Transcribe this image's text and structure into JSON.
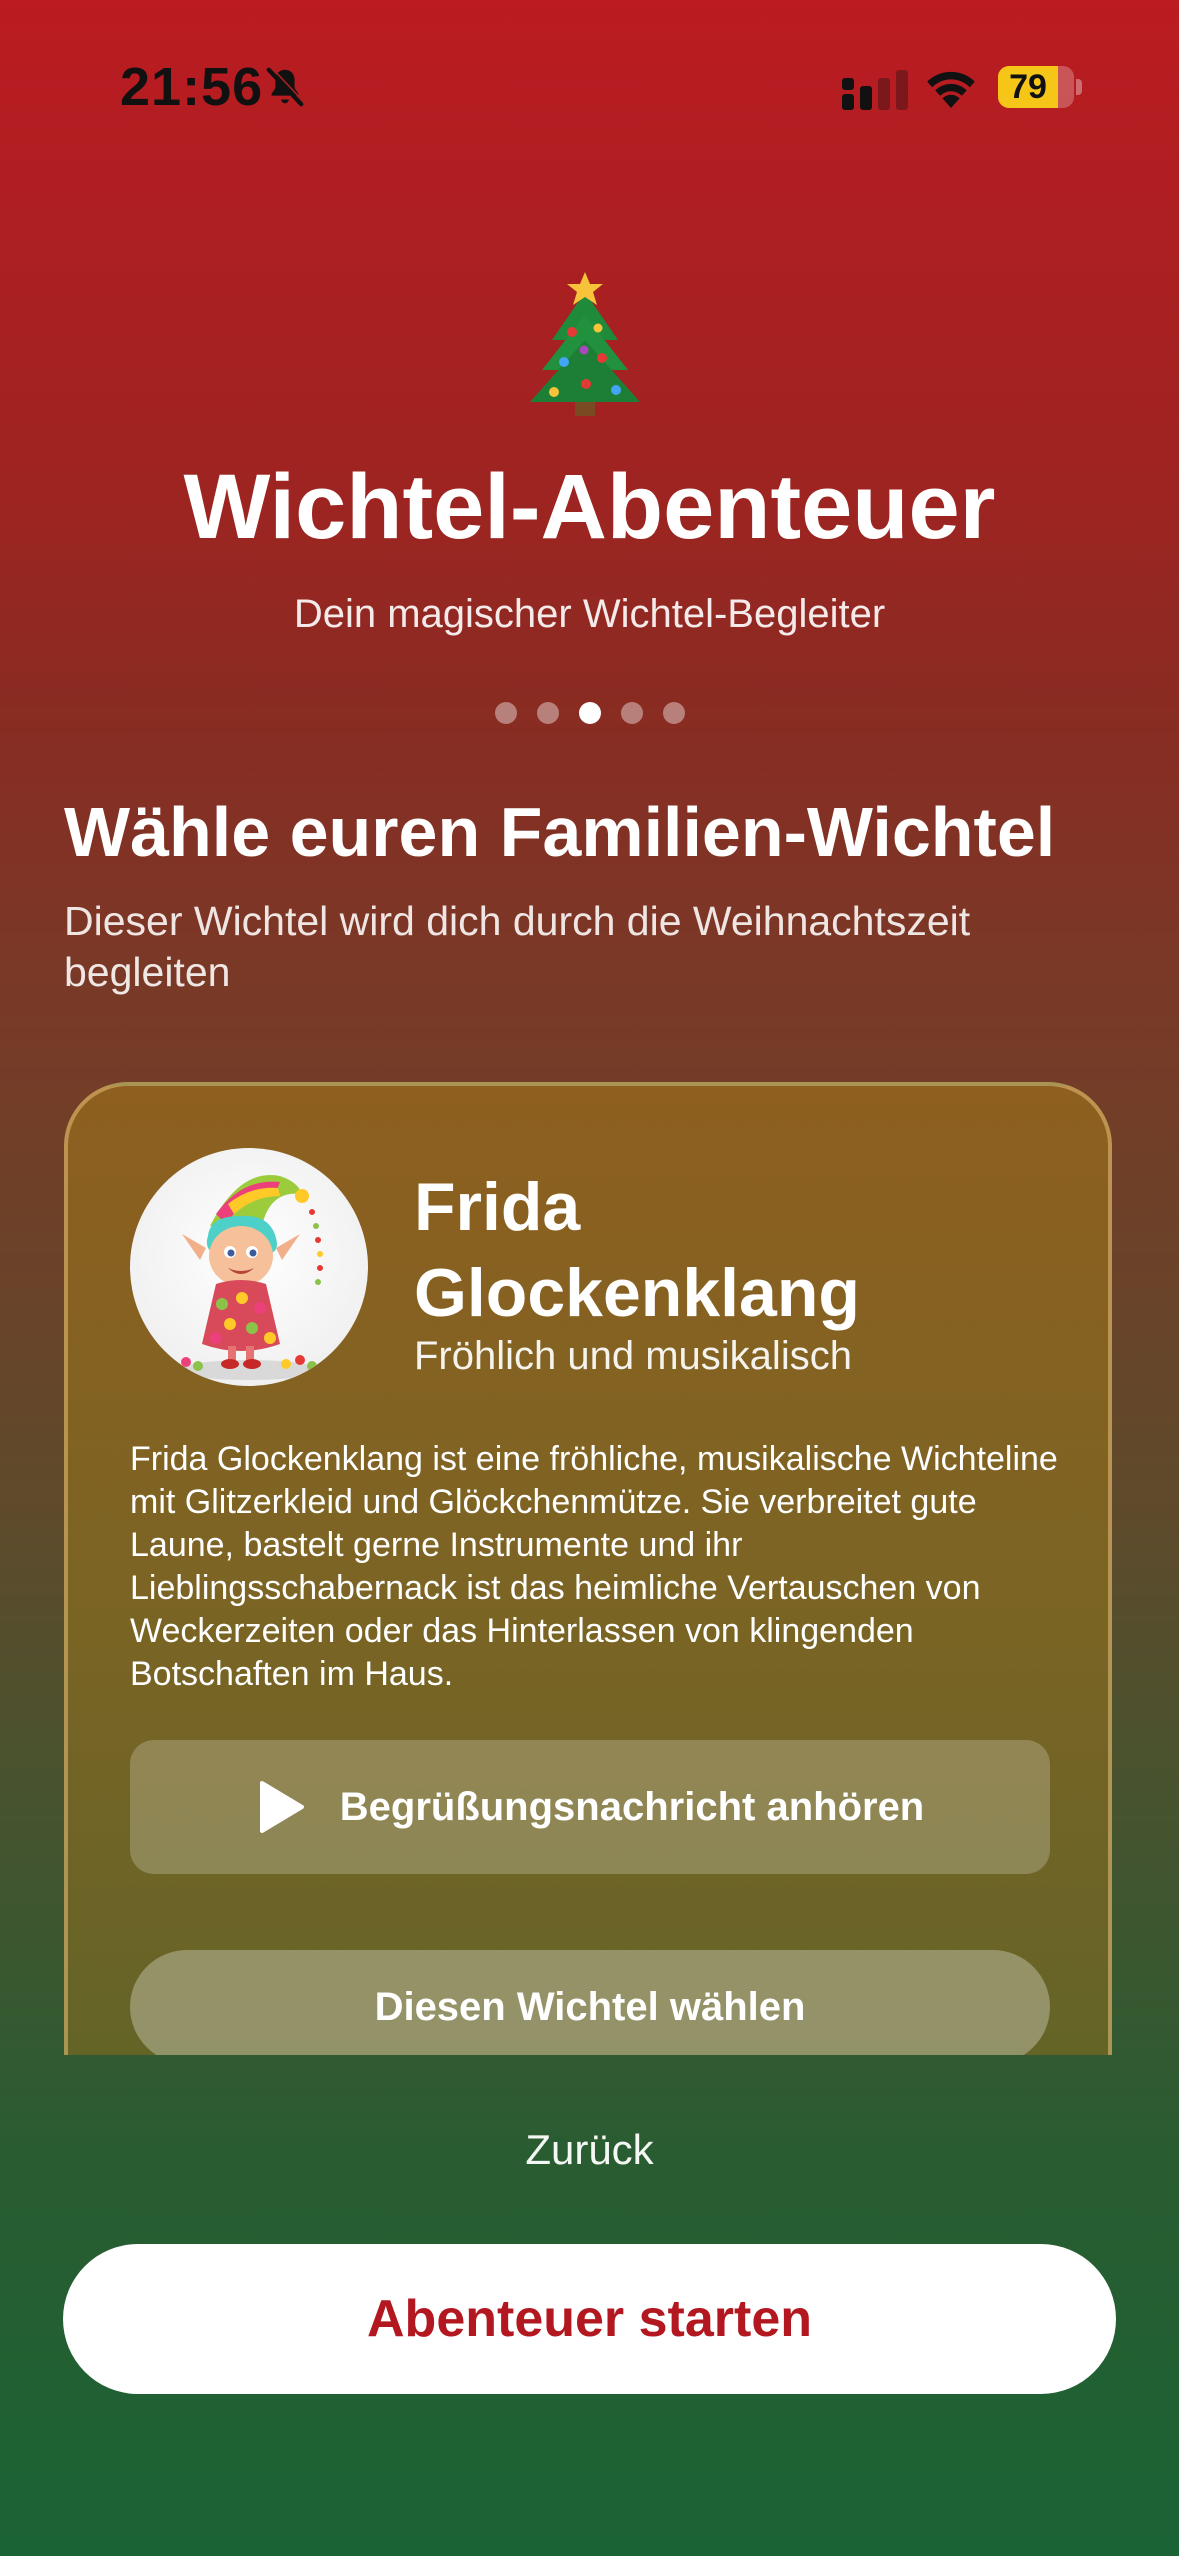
{
  "status_bar": {
    "time": "21:56",
    "battery_percent": "79",
    "battery_level": 0.79,
    "icons": [
      "bell-slash-icon",
      "cellular-signal-icon",
      "wifi-icon",
      "battery-icon"
    ]
  },
  "header": {
    "icon": "christmas-tree-icon",
    "title": "Wichtel-Abenteuer",
    "subtitle": "Dein magischer Wichtel-Begleiter",
    "page_count": 5,
    "current_page": 3
  },
  "section": {
    "title": "Wähle euren Familien-Wichtel",
    "description": "Dieser Wichtel wird dich durch die Weihnachtszeit begleiten"
  },
  "elf_card": {
    "name": "Frida Glockenklang",
    "trait": "Fröhlich und musikalisch",
    "description": "Frida Glockenklang ist eine fröhliche, musikalische Wichteline mit Glitzerkleid und Glöckchenmütze. Sie verbreitet gute Laune, bastelt gerne Instrumente und ihr Lieblingsschabernack ist das heimliche Vertauschen von Weckerzeiten oder das Hinterlassen von klingenden Botschaften im Haus.",
    "listen_label": "Begrüßungsnachricht anhören",
    "choose_label": "Diesen Wichtel wählen"
  },
  "footer": {
    "back_label": "Zurück",
    "start_label": "Abenteuer starten"
  },
  "colors": {
    "gradient_top": "#bb1b21",
    "gradient_bottom": "#1a6334",
    "start_button_text": "#b3171f",
    "battery_fill": "#f5c518"
  }
}
